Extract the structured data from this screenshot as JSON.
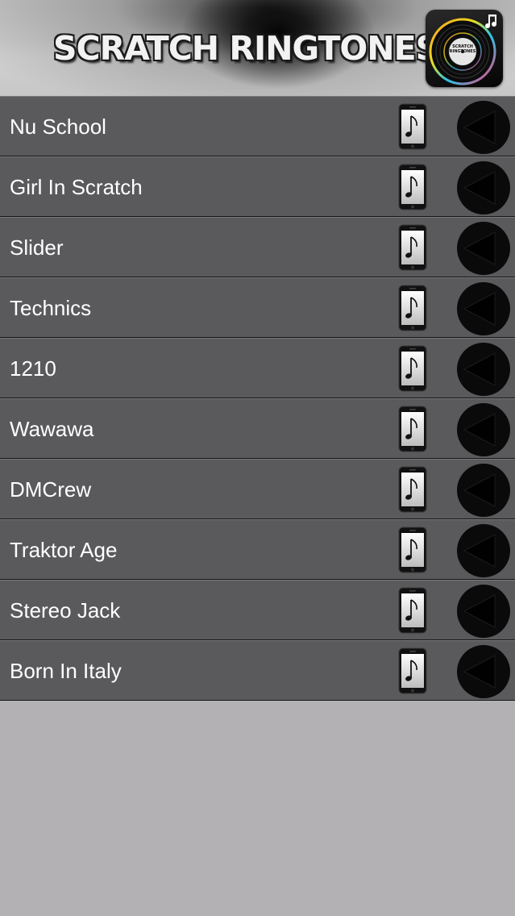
{
  "header": {
    "title": "SCRATCH RINGTONES",
    "app_icon": {
      "icon": "vinyl-record-icon",
      "label": "SCRATCH RINGTONES"
    }
  },
  "ringtones": [
    {
      "name": "Nu School"
    },
    {
      "name": "Girl In Scratch"
    },
    {
      "name": "Slider"
    },
    {
      "name": "Technics"
    },
    {
      "name": "1210"
    },
    {
      "name": "Wawawa"
    },
    {
      "name": "DMCrew"
    },
    {
      "name": "Traktor Age"
    },
    {
      "name": "Stereo Jack"
    },
    {
      "name": "Born In Italy"
    }
  ],
  "icons": {
    "set_ringtone": "phone-music-note-icon",
    "play": "play-icon"
  },
  "colors": {
    "row_background": "#5a595c",
    "page_background": "#b3b1b4",
    "row_text": "#ffffff"
  }
}
